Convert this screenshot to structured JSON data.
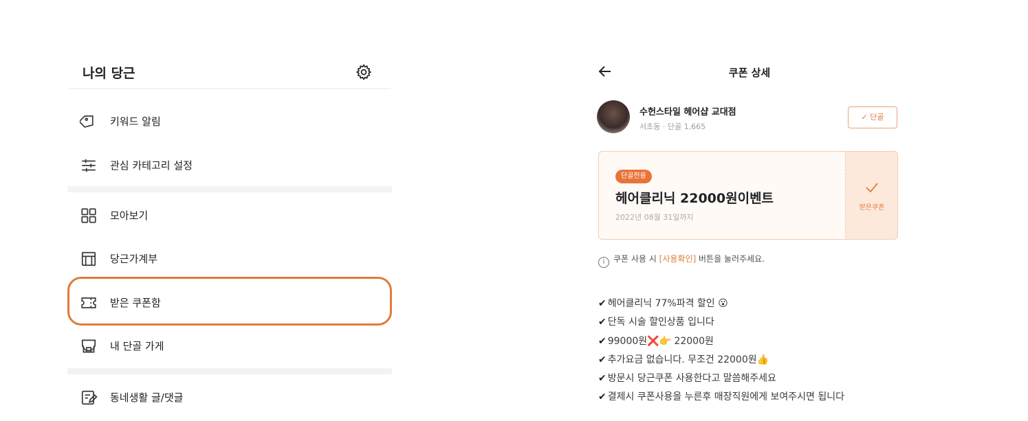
{
  "left": {
    "title": "나의 당근",
    "menu": [
      {
        "label": "키워드 알림",
        "icon": "tag-icon"
      },
      {
        "label": "관심 카테고리 설정",
        "icon": "sliders-icon"
      },
      {
        "label": "모아보기",
        "icon": "grid-icon"
      },
      {
        "label": "당근가계부",
        "icon": "ledger-icon"
      },
      {
        "label": "받은 쿠폰함",
        "icon": "coupon-icon"
      },
      {
        "label": "내 단골 가게",
        "icon": "store-icon"
      },
      {
        "label": "동네생활 글/댓글",
        "icon": "edit-note-icon"
      }
    ]
  },
  "right": {
    "title": "쿠폰 상세",
    "shop": {
      "name": "수헌스타일 헤어샵 교대점",
      "meta": "서초동 · 단골 1,665"
    },
    "regular_button": "✓ 단골",
    "coupon": {
      "badge": "단골전용",
      "title": "헤어클리닉 22000원이벤트",
      "date": "2022년 08월 31일까지",
      "side_label": "받은쿠폰"
    },
    "notice": {
      "before": "쿠폰 사용 시 ",
      "accent": "[사용확인]",
      "after": " 버튼을 눌러주세요."
    },
    "description": [
      "헤어클리닉 77%파격 할인 😮",
      "단독 시술 할인상품 입니다",
      "99000원❌👉 22000원",
      "추가요금 없습니다. 무조건 22000원👍",
      "방문시 당근쿠폰 사용한다고 말씀해주세요",
      "결제시 쿠폰사용을 누른후 매장직원에게 보여주시면 됩니다"
    ],
    "check_mark": "✔"
  },
  "colors": {
    "accent": "#e07a3c",
    "badge": "#e8743a",
    "divider": "#f2f3f5"
  }
}
